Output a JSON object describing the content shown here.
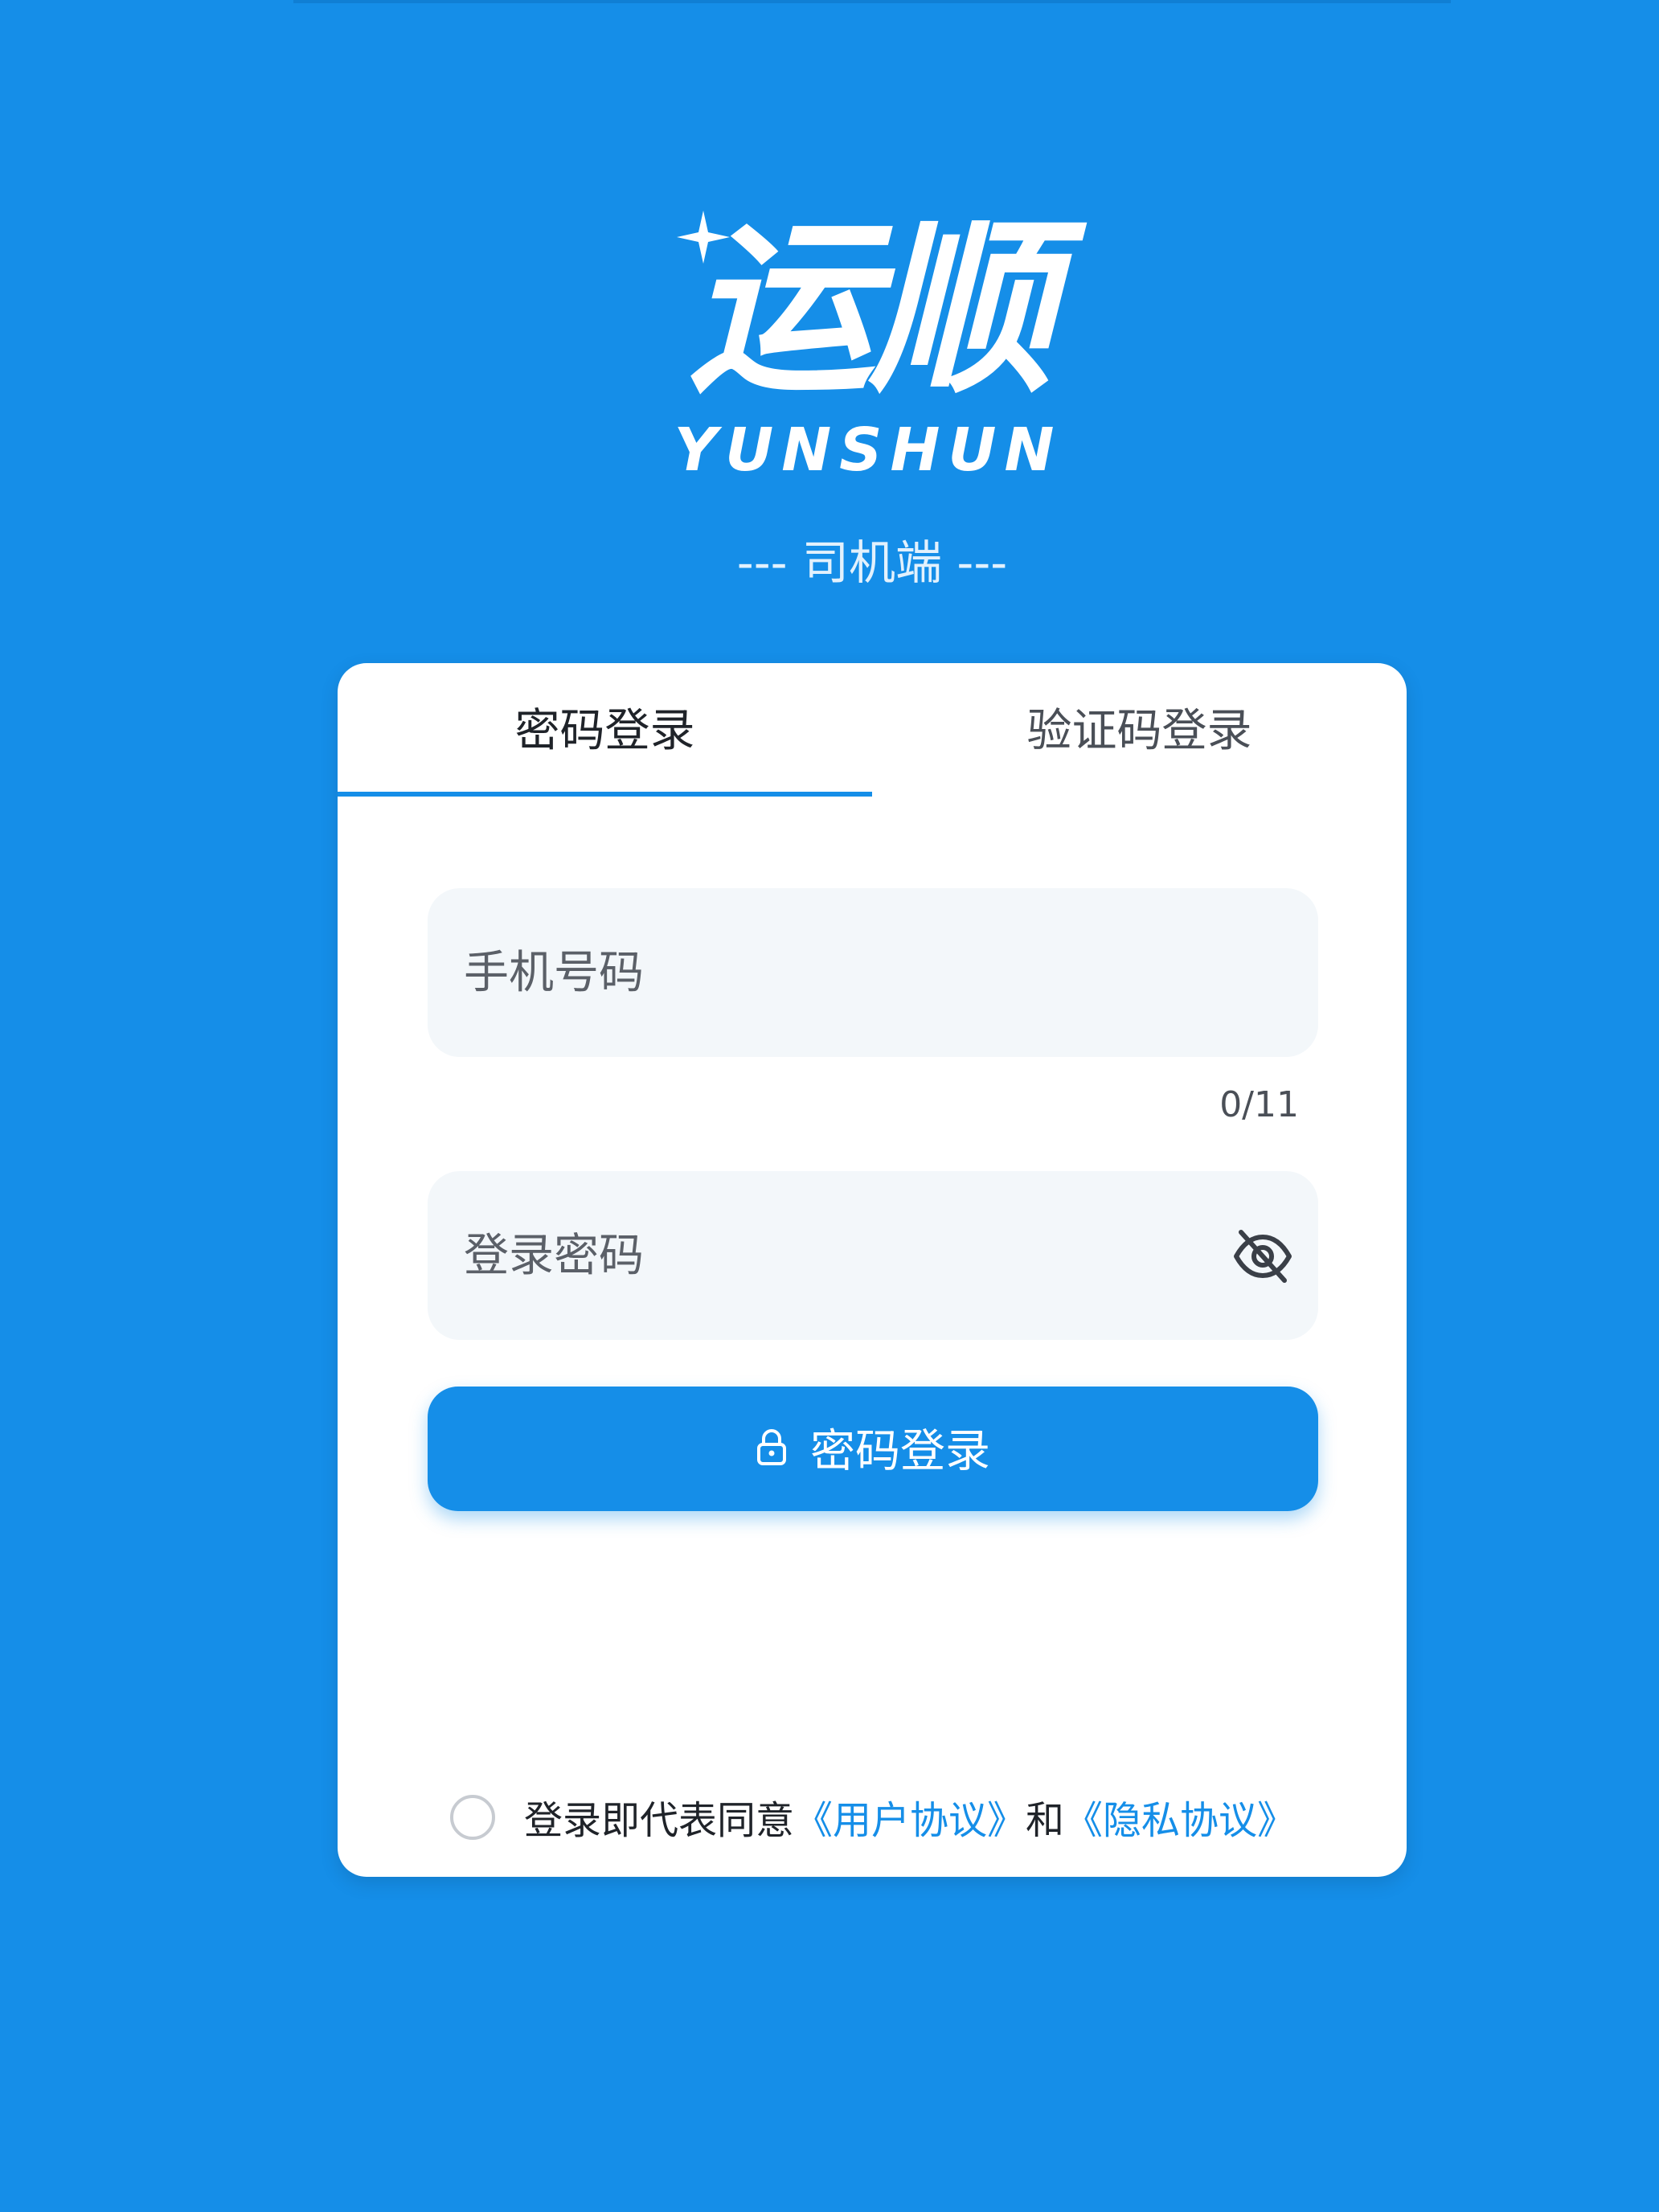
{
  "logo": {
    "wordmark": "运顺",
    "sub": "YUNSHUN"
  },
  "subtitle": "--- 司机端 ---",
  "tabs": [
    {
      "label": "密码登录",
      "active": true
    },
    {
      "label": "验证码登录",
      "active": false
    }
  ],
  "phone": {
    "placeholder": "手机号码",
    "value": "",
    "counter": "0/11"
  },
  "password": {
    "placeholder": "登录密码",
    "value": ""
  },
  "login_button": {
    "icon": "lock-icon",
    "label": "密码登录"
  },
  "agreement": {
    "prefix": "登录即代表同意",
    "user_link": "《用户协议》",
    "joiner": "和",
    "privacy_link": "《隐私协议》",
    "checked": false
  },
  "colors": {
    "background": "#158ee8",
    "accent": "#158ee8",
    "field_bg": "#f3f7fa",
    "card": "#ffffff"
  }
}
